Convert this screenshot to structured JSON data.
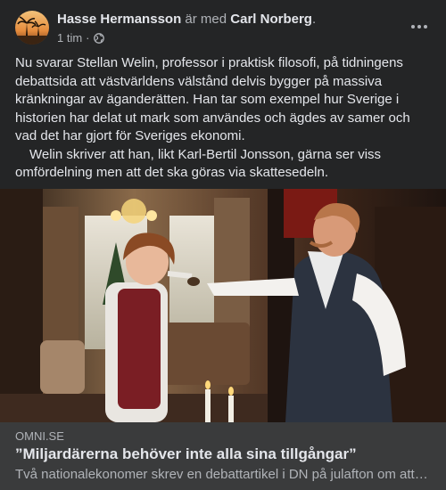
{
  "post": {
    "author": "Hasse Hermansson",
    "with_text": "är med",
    "tagged": "Carl Norberg",
    "period": ".",
    "time": "1 tim",
    "separator": "·",
    "privacy_icon": "globe-icon",
    "more_icon": "more-options-icon",
    "paragraph1": "Nu svarar Stellan Welin, professor i praktisk filosofi, på tidningens debattsida att västvärldens välstånd delvis bygger på massiva kränkningar av äganderätten. Han tar som exempel hur Sverige i historien har delat ut mark som användes och ägdes av samer och vad det har gjort för Sveriges ekonomi.",
    "paragraph2": "Welin skriver att han, likt Karl-Bertil Jonsson, gärna ser viss omfördelning men att det ska göras via skattesedeln."
  },
  "link_preview": {
    "domain": "OMNI.SE",
    "headline": "”Miljardärerna behöver inte alla sina tillgångar”",
    "description": "Två nationalekonomer skrev en debattartikel i DN på julafton om att de..."
  },
  "colors": {
    "background": "#242526",
    "preview_background": "#3a3b3c",
    "primary_text": "#e4e6eb",
    "secondary_text": "#b0b3b8"
  }
}
